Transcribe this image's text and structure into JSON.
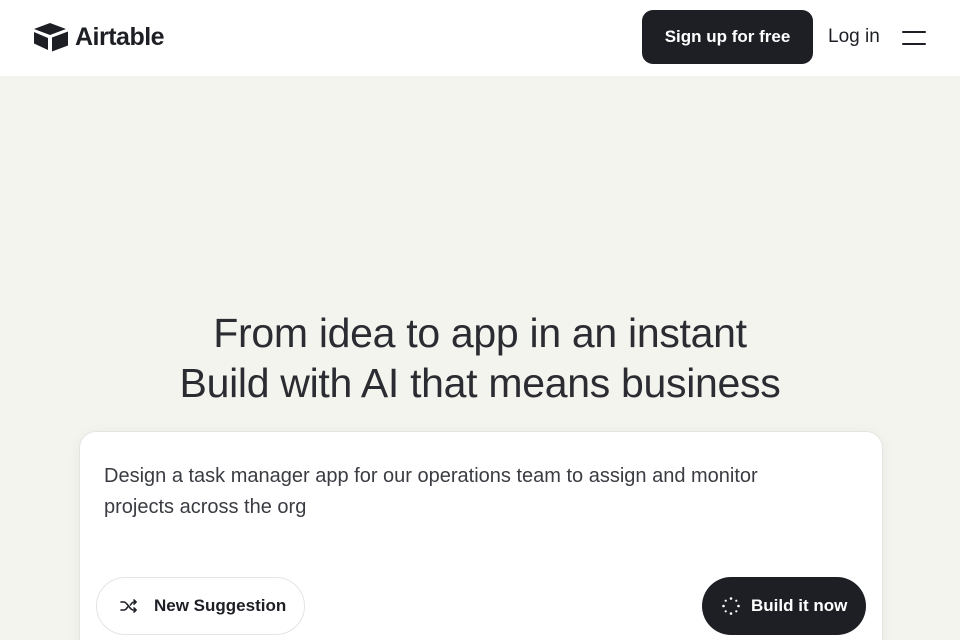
{
  "header": {
    "logo_text": "Airtable",
    "logo_icon": "airtable-logo-icon",
    "signup_label": "Sign up for free",
    "login_label": "Log in",
    "menu_icon": "hamburger-menu-icon"
  },
  "hero": {
    "line1": "From idea to app in an instant",
    "line2": "Build with AI that means business"
  },
  "prompt": {
    "text": "Design a task manager app for our operations team to assign and monitor projects across the org",
    "suggestion_label": "New Suggestion",
    "suggestion_icon": "shuffle-icon",
    "build_label": "Build it now",
    "build_icon": "sparkle-loader-icon"
  },
  "colors": {
    "page_background": "#f4f4ef",
    "header_background": "#ffffff",
    "primary_button": "#1d1f25",
    "text_primary": "#1d1f25"
  }
}
